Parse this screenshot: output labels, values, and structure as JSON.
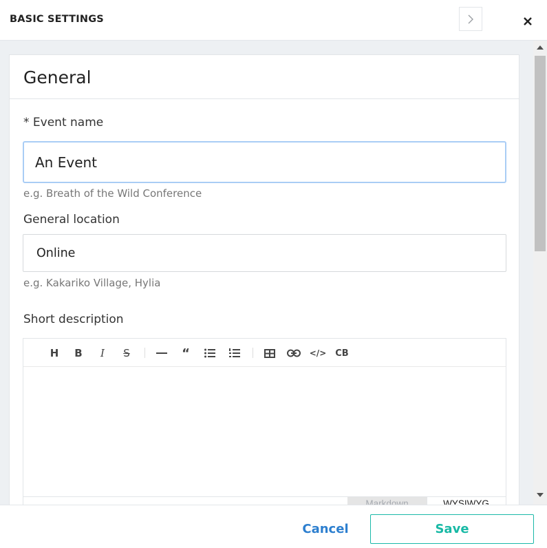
{
  "header": {
    "title": "BASIC SETTINGS",
    "next_icon": "chevron-right-icon",
    "close_icon": "close-icon"
  },
  "card": {
    "title": "General"
  },
  "fields": {
    "event_name": {
      "label": "* Event name",
      "value": "An Event",
      "hint": "e.g. Breath of the Wild Conference"
    },
    "general_location": {
      "label": "General location",
      "value": "Online",
      "hint": "e.g. Kakariko Village, Hylia"
    },
    "short_description": {
      "label": "Short description",
      "value": ""
    }
  },
  "editor": {
    "toolbar": [
      {
        "name": "heading-icon",
        "glyph": "H"
      },
      {
        "name": "bold-icon",
        "glyph": "B"
      },
      {
        "name": "italic-icon",
        "glyph": "I"
      },
      {
        "name": "strikethrough-icon",
        "glyph": "S"
      },
      {
        "name": "horizontal-rule-icon",
        "glyph": "—"
      },
      {
        "name": "quote-icon",
        "glyph": "“"
      },
      {
        "name": "bullet-list-icon",
        "glyph": ""
      },
      {
        "name": "numbered-list-icon",
        "glyph": ""
      },
      {
        "name": "table-icon",
        "glyph": ""
      },
      {
        "name": "link-icon",
        "glyph": ""
      },
      {
        "name": "code-icon",
        "glyph": "</>"
      },
      {
        "name": "codeblock-icon",
        "glyph": "CB"
      }
    ],
    "modes": {
      "markdown": "Markdown",
      "wysiwyg": "WYSIWYG"
    },
    "active_mode": "WYSIWYG"
  },
  "footer": {
    "cancel_label": "Cancel",
    "save_label": "Save"
  },
  "colors": {
    "accent_teal": "#18b9a5",
    "link_blue": "#2d7fcf",
    "focus_border": "#a9cdf5",
    "panel_bg": "#edf0f3"
  }
}
